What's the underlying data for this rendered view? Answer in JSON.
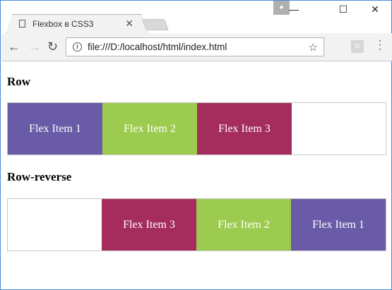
{
  "browser": {
    "tab_title": "Flexbox в CSS3",
    "url": "file:///D:/localhost/html/index.html"
  },
  "page": {
    "sections": [
      {
        "heading": "Row",
        "items": [
          "Flex Item 1",
          "Flex Item 2",
          "Flex Item 3"
        ]
      },
      {
        "heading": "Row-reverse",
        "items": [
          "Flex Item 1",
          "Flex Item 2",
          "Flex Item 3"
        ]
      }
    ]
  },
  "colors": {
    "item1": "#6a5ba8",
    "item2": "#9dcb50",
    "item3": "#a52d5e"
  }
}
